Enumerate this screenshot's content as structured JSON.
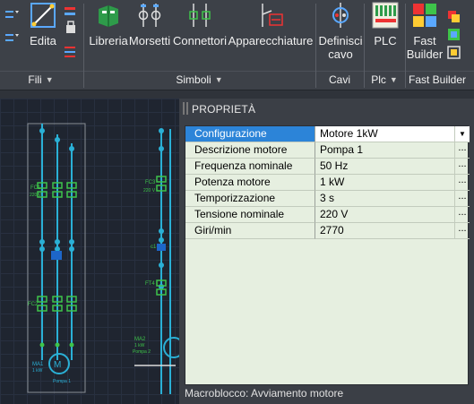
{
  "ribbon": {
    "fili": {
      "buttons": [
        {
          "label": "Edita"
        }
      ],
      "footer": "Fili"
    },
    "simboli": {
      "buttons": [
        {
          "label": "Libreria"
        },
        {
          "label": "Morsetti"
        },
        {
          "label": "Connettori"
        },
        {
          "label": "Apparecchiature"
        }
      ],
      "footer": "Simboli"
    },
    "cavi": {
      "buttons": [
        {
          "label": "Definisci\ncavo"
        }
      ],
      "footer": "Cavi"
    },
    "plc": {
      "buttons": [
        {
          "label": "PLC"
        }
      ],
      "footer": "Plc"
    },
    "fastbuilder": {
      "buttons": [
        {
          "label": "Fast\nBuilder"
        }
      ],
      "footer": "Fast Builder"
    },
    "dropdown_glyph": "▼"
  },
  "panel": {
    "title": "PROPRIETÀ",
    "rows": [
      {
        "key": "Configurazione",
        "value": "Motore 1kW",
        "action": "▼",
        "selected": true
      },
      {
        "key": "Descrizione motore",
        "value": "Pompa 1",
        "action": "..."
      },
      {
        "key": "Frequenza nominale",
        "value": "50 Hz",
        "action": "..."
      },
      {
        "key": "Potenza motore",
        "value": "1 kW",
        "action": "..."
      },
      {
        "key": "Temporizzazione",
        "value": "3 s",
        "action": "..."
      },
      {
        "key": "Tensione nominale",
        "value": "220 V",
        "action": "..."
      },
      {
        "key": "Giri/min",
        "value": "2770",
        "action": "..."
      }
    ],
    "status": "Macroblocco: Avviamento motore"
  },
  "drawing": {
    "labels": {
      "fc1": "FC1",
      "fc1_sub": "220 V",
      "fc2": "FC2",
      "ma1": "MA1",
      "ma1_sub": "1 kW",
      "pompa1": "Pompa 1",
      "fc3": "FC3",
      "fc3_sub": "220 V",
      "c1": "c1",
      "ft4": "FT4",
      "ma2": "MA2",
      "ma2_sub1": "1 kW",
      "ma2_sub2": "Pompa 2"
    }
  },
  "colors": {
    "accent": "#2c84d8",
    "wire": "#2ab0d6",
    "terminal": "#3ec44a",
    "grid_bg": "#e6efe0",
    "ribbon_bg": "#3d4148"
  }
}
